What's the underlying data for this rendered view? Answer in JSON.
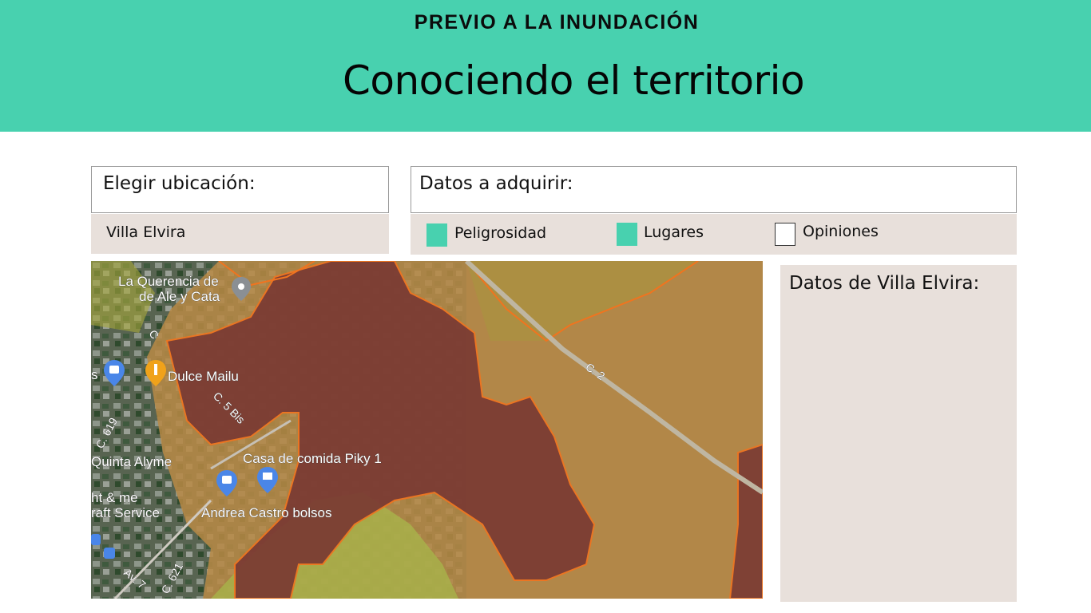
{
  "header": {
    "kicker": "PREVIO A LA INUNDACIÓN",
    "title": "Conociendo el territorio"
  },
  "location": {
    "label": "Elegir ubicación:",
    "value": "Villa Elvira"
  },
  "data_selection": {
    "label": "Datos a adquirir:",
    "options": [
      {
        "label": "Peligrosidad",
        "checked": true
      },
      {
        "label": "Lugares",
        "checked": true
      },
      {
        "label": "Opiniones",
        "checked": false
      }
    ]
  },
  "map": {
    "places": [
      "La Querencia de",
      "de Ale y Cata",
      "Dulce Mailu",
      "Quinta Alyme",
      "Casa de comida Piky 1",
      "ht & me",
      "raft Service",
      "Andrea Castro bolsos",
      "s"
    ],
    "roads": [
      "C. 2",
      "C. 5 Bis",
      "C. 619",
      "C. 621",
      "Av. 7",
      "C"
    ],
    "colors": {
      "high_hazard": "#7a3a33",
      "medium_hazard": "#b88a45",
      "low_hazard": "#a8b04a",
      "hazard_outline": "#f0741f",
      "accent": "#48d1af"
    }
  },
  "details": {
    "title": "Datos de Villa Elvira:"
  }
}
